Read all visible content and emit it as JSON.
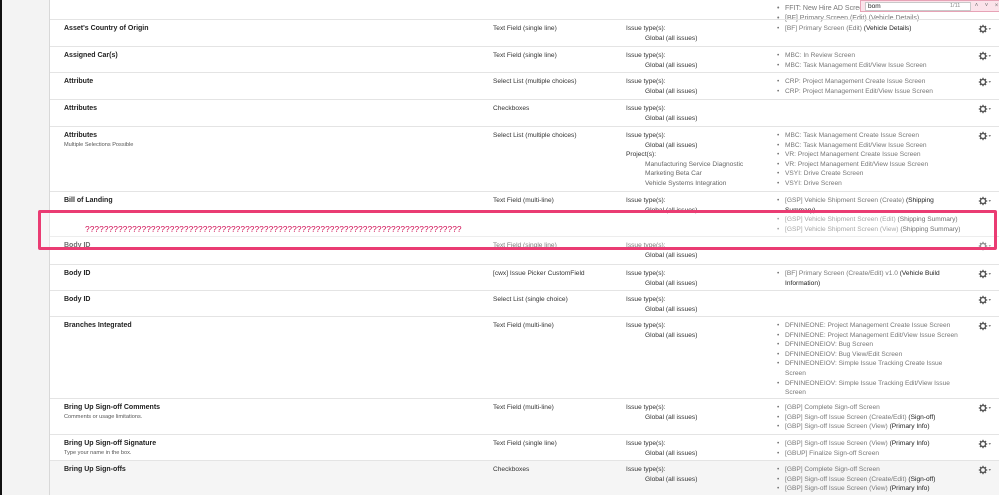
{
  "find_bar": {
    "query": "bom",
    "count": "1/11",
    "prev_icon": "˄",
    "next_icon": "˅",
    "close_icon": "×"
  },
  "top_screens": [
    "FFIT: New Hire AD Screen",
    "[BF] Primary Screen (Edit) (Vehicle Details)"
  ],
  "overlay_text": "????????????????????????????????????????????????????????????????????????????????",
  "rows": [
    {
      "name": "Asset's Country of Origin",
      "type": "Text Field (single line)",
      "ctx": [
        "Issue type(s):",
        "Global (all issues)"
      ],
      "screens": [
        [
          "[BF] Primary Screen (Edit) ",
          "(Vehicle Details)"
        ]
      ]
    },
    {
      "name": "Assigned Car(s)",
      "type": "Text Field (single line)",
      "ctx": [
        "Issue type(s):",
        "Global (all issues)"
      ],
      "screens": [
        [
          "MBC: In Review Screen",
          ""
        ],
        [
          "MBC: Task Management Edit/View Issue Screen",
          ""
        ]
      ]
    },
    {
      "name": "Attribute",
      "type": "Select List (multiple choices)",
      "ctx": [
        "Issue type(s):",
        "Global (all issues)"
      ],
      "screens": [
        [
          "CRP: Project Management Create Issue Screen",
          ""
        ],
        [
          "CRP: Project Management Edit/View Issue Screen",
          ""
        ]
      ]
    },
    {
      "name": "Attributes",
      "type": "Checkboxes",
      "ctx": [
        "Issue type(s):",
        "Global (all issues)"
      ],
      "screens": []
    },
    {
      "name": "Attributes",
      "desc": "Multiple Selections Possible",
      "type": "Select List (multiple choices)",
      "ctx": [
        "Issue type(s):",
        "Global (all issues)",
        "Project(s):",
        "Manufacturing Service Diagnostic",
        "Marketing Beta Car",
        "Vehicle Systems Integration"
      ],
      "screens": [
        [
          "MBC: Task Management Create Issue Screen",
          ""
        ],
        [
          "MBC: Task Management Edit/View Issue Screen",
          ""
        ],
        [
          "VR: Project Management Create Issue Screen",
          ""
        ],
        [
          "VR: Project Management Edit/View Issue Screen",
          ""
        ],
        [
          "VSYI: Drive Create Screen",
          ""
        ],
        [
          "VSYI: Drive Screen",
          ""
        ]
      ]
    },
    {
      "name": "Bill of Landing",
      "type": "Text Field (multi-line)",
      "ctx": [
        "Issue type(s):",
        "Global (all issues)"
      ],
      "screens": [
        [
          "[GSP] Vehicle Shipment Screen (Create) ",
          "(Shipping Summary)"
        ],
        [
          "[GSP] Vehicle Shipment Screen (Edit) ",
          "(Shipping Summary)"
        ],
        [
          "[GSP] Vehicle Shipment Screen (View) ",
          "(Shipping Summary)"
        ]
      ]
    },
    {
      "name": "Body ID",
      "type": "Text Field (single line)",
      "ctx": [
        "Issue type(s):",
        "Global (all issues)"
      ],
      "screens": []
    },
    {
      "name": "Body ID",
      "type": "[cwx] Issue Picker CustomField",
      "ctx": [
        "Issue type(s):",
        "Global (all issues)"
      ],
      "screens": [
        [
          "[BF] Primary Screen (Create/Edit) v1.0 ",
          "(Vehicle Build Information)"
        ]
      ]
    },
    {
      "name": "Body ID",
      "type": "Select List (single choice)",
      "ctx": [
        "Issue type(s):",
        "Global (all issues)"
      ],
      "screens": []
    },
    {
      "name": "Branches Integrated",
      "type": "Text Field (multi-line)",
      "ctx": [
        "Issue type(s):",
        "Global (all issues)"
      ],
      "screens": [
        [
          "DFNINEONE: Project Management Create Issue Screen",
          ""
        ],
        [
          "DFNINEONE: Project Management Edit/View Issue Screen",
          ""
        ],
        [
          "DFNINEONEIOV: Bug Screen",
          ""
        ],
        [
          "DFNINEONEIOV: Bug View/Edit Screen",
          ""
        ],
        [
          "DFNINEONEIOV: Simple Issue Tracking Create Issue Screen",
          ""
        ],
        [
          "DFNINEONEIOV: Simple Issue Tracking Edit/View Issue Screen",
          ""
        ]
      ]
    },
    {
      "name": "Bring Up Sign-off Comments",
      "desc": "Comments or usage limitations.",
      "type": "Text Field (multi-line)",
      "ctx": [
        "Issue type(s):",
        "Global (all issues)"
      ],
      "screens": [
        [
          "[GBP] Complete Sign-off Screen",
          ""
        ],
        [
          "[GBP] Sign-off Issue Screen (Create/Edit) ",
          "(Sign-off)"
        ],
        [
          "[GBP] Sign-off Issue Screen (View) ",
          "(Primary Info)"
        ]
      ]
    },
    {
      "name": "Bring Up Sign-off Signature",
      "desc": "Type your name in the box.",
      "type": "Text Field (single line)",
      "ctx": [
        "Issue type(s):",
        "Global (all issues)"
      ],
      "screens": [
        [
          "[GBP] Sign-off Issue Screen (View) ",
          "(Primary Info)"
        ],
        [
          "[GBUP] Finalize Sign-off Screen",
          ""
        ]
      ]
    },
    {
      "name": "Bring Up Sign-offs",
      "type": "Checkboxes",
      "ctx": [
        "Issue type(s):",
        "Global (all issues)"
      ],
      "screens": [
        [
          "[GBP] Complete Sign-off Screen",
          ""
        ],
        [
          "[GBP] Sign-off Issue Screen (Create/Edit) ",
          "(Sign-off)"
        ],
        [
          "[GBP] Sign-off Issue Screen (View) ",
          "(Primary Info)"
        ]
      ]
    }
  ]
}
